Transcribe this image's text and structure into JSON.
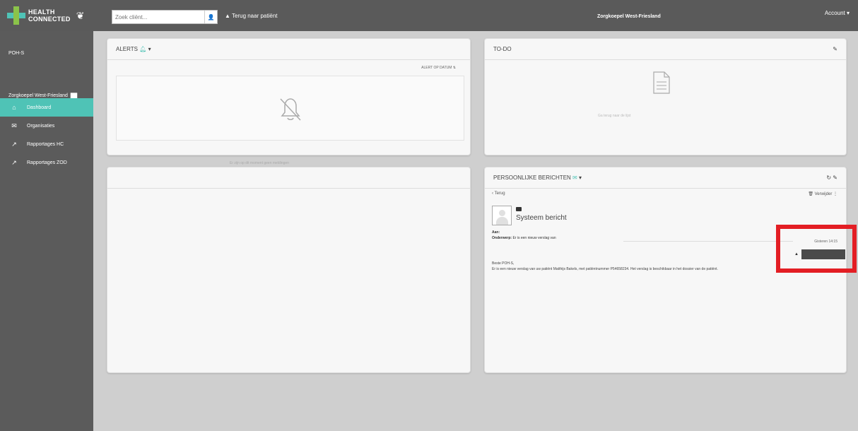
{
  "header": {
    "logo_line1": "HEALTH",
    "logo_line2": "CONNECTED",
    "search_placeholder": "Zoek cliënt...",
    "back_patient": "Terug naar patiënt",
    "center_title": "Zorgkoepel West-Friesland",
    "account": "Account ▾"
  },
  "sidebar": {
    "user": "POH-S",
    "organization": "Zorgkoepel West-Friesland",
    "items": [
      {
        "label": "Dashboard",
        "icon": "home-icon",
        "active": true
      },
      {
        "label": "Organisaties",
        "icon": "envelope-icon",
        "active": false
      },
      {
        "label": "Rapportages HC",
        "icon": "chart-icon",
        "active": false
      },
      {
        "label": "Rapportages ZOD",
        "icon": "chart-icon",
        "active": false
      }
    ]
  },
  "alerts": {
    "title": "ALERTS",
    "sort_label": "ALERT OP DATUM",
    "empty_text": "Er zijn op dit moment geen meldingen"
  },
  "todo": {
    "title": "TO-DO",
    "empty_text": "Ga terug naar de lijst"
  },
  "messages": {
    "title": "PERSOONLIJKE BERICHTEN",
    "back": "Terug",
    "delete": "Verwijder",
    "from": "Systeem bericht",
    "to_label": "Aan:",
    "subject_label": "Onderwerp:",
    "subject": "Er is een nieuw verslag van",
    "date": "Gisteren 14:15",
    "greeting": "Beste POH-S,",
    "body": "Er is een nieuw verslag van uw patiënt Matthijs Bakels, met patiëntnummer P54658234. Het verslag is beschikbaar in het dossier van de patiënt."
  },
  "colors": {
    "accent": "#4fc3b6",
    "topbar": "#5a5a5a",
    "sidebar": "#5b5b5b",
    "highlight": "#e31e24"
  }
}
